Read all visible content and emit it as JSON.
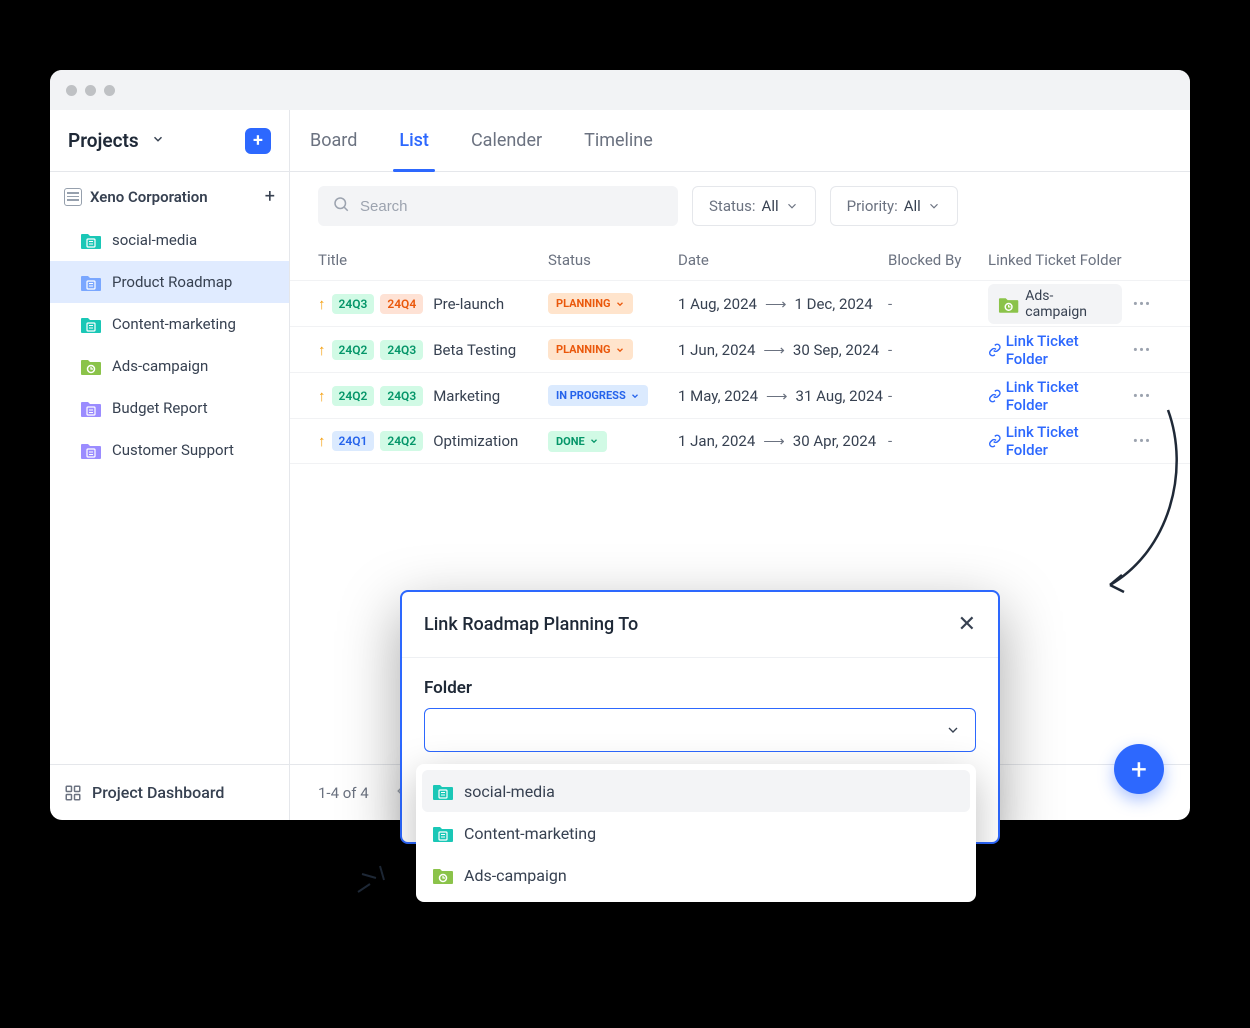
{
  "sidebar": {
    "title": "Projects",
    "org": "Xeno Corporation",
    "items": [
      {
        "label": "social-media",
        "color": "teal"
      },
      {
        "label": "Product Roadmap",
        "color": "blue",
        "active": true
      },
      {
        "label": "Content-marketing",
        "color": "teal"
      },
      {
        "label": "Ads-campaign",
        "color": "green"
      },
      {
        "label": "Budget Report",
        "color": "purple"
      },
      {
        "label": "Customer Support",
        "color": "purple"
      }
    ],
    "footer": "Project Dashboard"
  },
  "tabs": [
    "Board",
    "List",
    "Calender",
    "Timeline"
  ],
  "active_tab": "List",
  "search": {
    "placeholder": "Search"
  },
  "filters": {
    "status": {
      "label": "Status:",
      "value": "All"
    },
    "priority": {
      "label": "Priority:",
      "value": "All"
    }
  },
  "columns": [
    "Title",
    "Status",
    "Date",
    "Blocked By",
    "Linked Ticket Folder"
  ],
  "rows": [
    {
      "tags": [
        "24Q3",
        "24Q4"
      ],
      "tagColors": [
        "green",
        "orange"
      ],
      "title": "Pre-launch",
      "status": "PLANNING",
      "statusType": "planning",
      "date1": "1 Aug, 2024",
      "date2": "1 Dec, 2024",
      "blocked": "-",
      "linked_chip": "Ads-campaign",
      "linked_link": null
    },
    {
      "tags": [
        "24Q2",
        "24Q3"
      ],
      "tagColors": [
        "green",
        "green"
      ],
      "title": "Beta Testing",
      "status": "PLANNING",
      "statusType": "planning",
      "date1": "1 Jun, 2024",
      "date2": "30 Sep, 2024",
      "blocked": "-",
      "linked_chip": null,
      "linked_link": "Link Ticket Folder"
    },
    {
      "tags": [
        "24Q2",
        "24Q3"
      ],
      "tagColors": [
        "green",
        "green"
      ],
      "title": "Marketing",
      "status": "IN PROGRESS",
      "statusType": "progress",
      "date1": "1 May, 2024",
      "date2": "31 Aug, 2024",
      "blocked": "-",
      "linked_chip": null,
      "linked_link": "Link Ticket Folder"
    },
    {
      "tags": [
        "24Q1",
        "24Q2"
      ],
      "tagColors": [
        "blue",
        "green"
      ],
      "title": "Optimization",
      "status": "DONE",
      "statusType": "done",
      "date1": "1 Jan, 2024",
      "date2": "30 Apr, 2024",
      "blocked": "-",
      "linked_chip": null,
      "linked_link": "Link Ticket Folder"
    }
  ],
  "pager": "1-4 of 4",
  "modal": {
    "title": "Link Roadmap Planning To",
    "field_label": "Folder"
  },
  "dropdown": [
    {
      "label": "social-media",
      "color": "teal"
    },
    {
      "label": "Content-marketing",
      "color": "teal"
    },
    {
      "label": "Ads-campaign",
      "color": "green"
    }
  ],
  "icons": {
    "folder_colors": {
      "teal": "#1ac7b6",
      "blue": "#7aa7ff",
      "green": "#8bc34a",
      "purple": "#9b8cff"
    }
  }
}
